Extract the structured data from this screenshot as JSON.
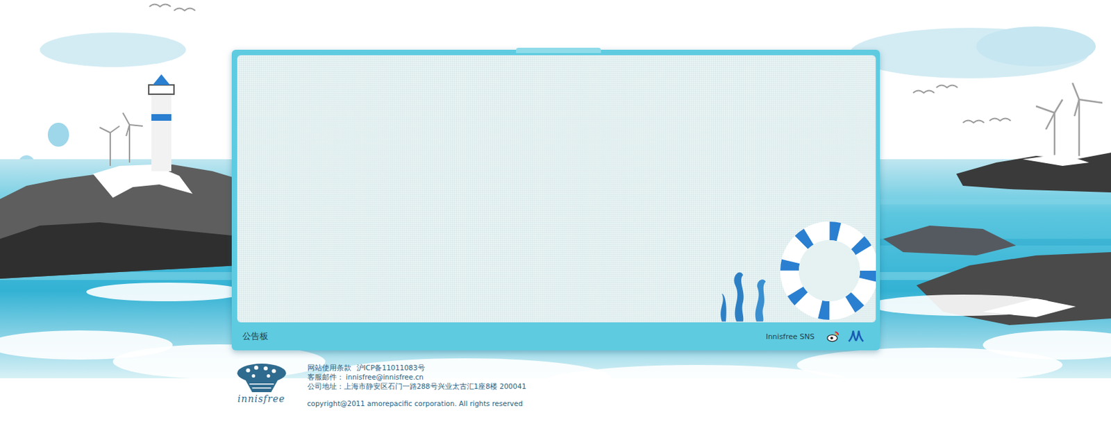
{
  "board": {
    "title": "公告板",
    "sns_label": "Innisfree SNS"
  },
  "footer": {
    "logo_text": "innisfree",
    "links": [
      "网站使用条款",
      "沪ICP备11011083号"
    ],
    "email": "客服邮件：  innisfree@innisfree.cn",
    "address": "公司地址：上海市静安区石门一路288号兴业太古汇1座8楼 200041",
    "copyright": "copyright@2011 amorepacific corporation. All rights reserved"
  }
}
